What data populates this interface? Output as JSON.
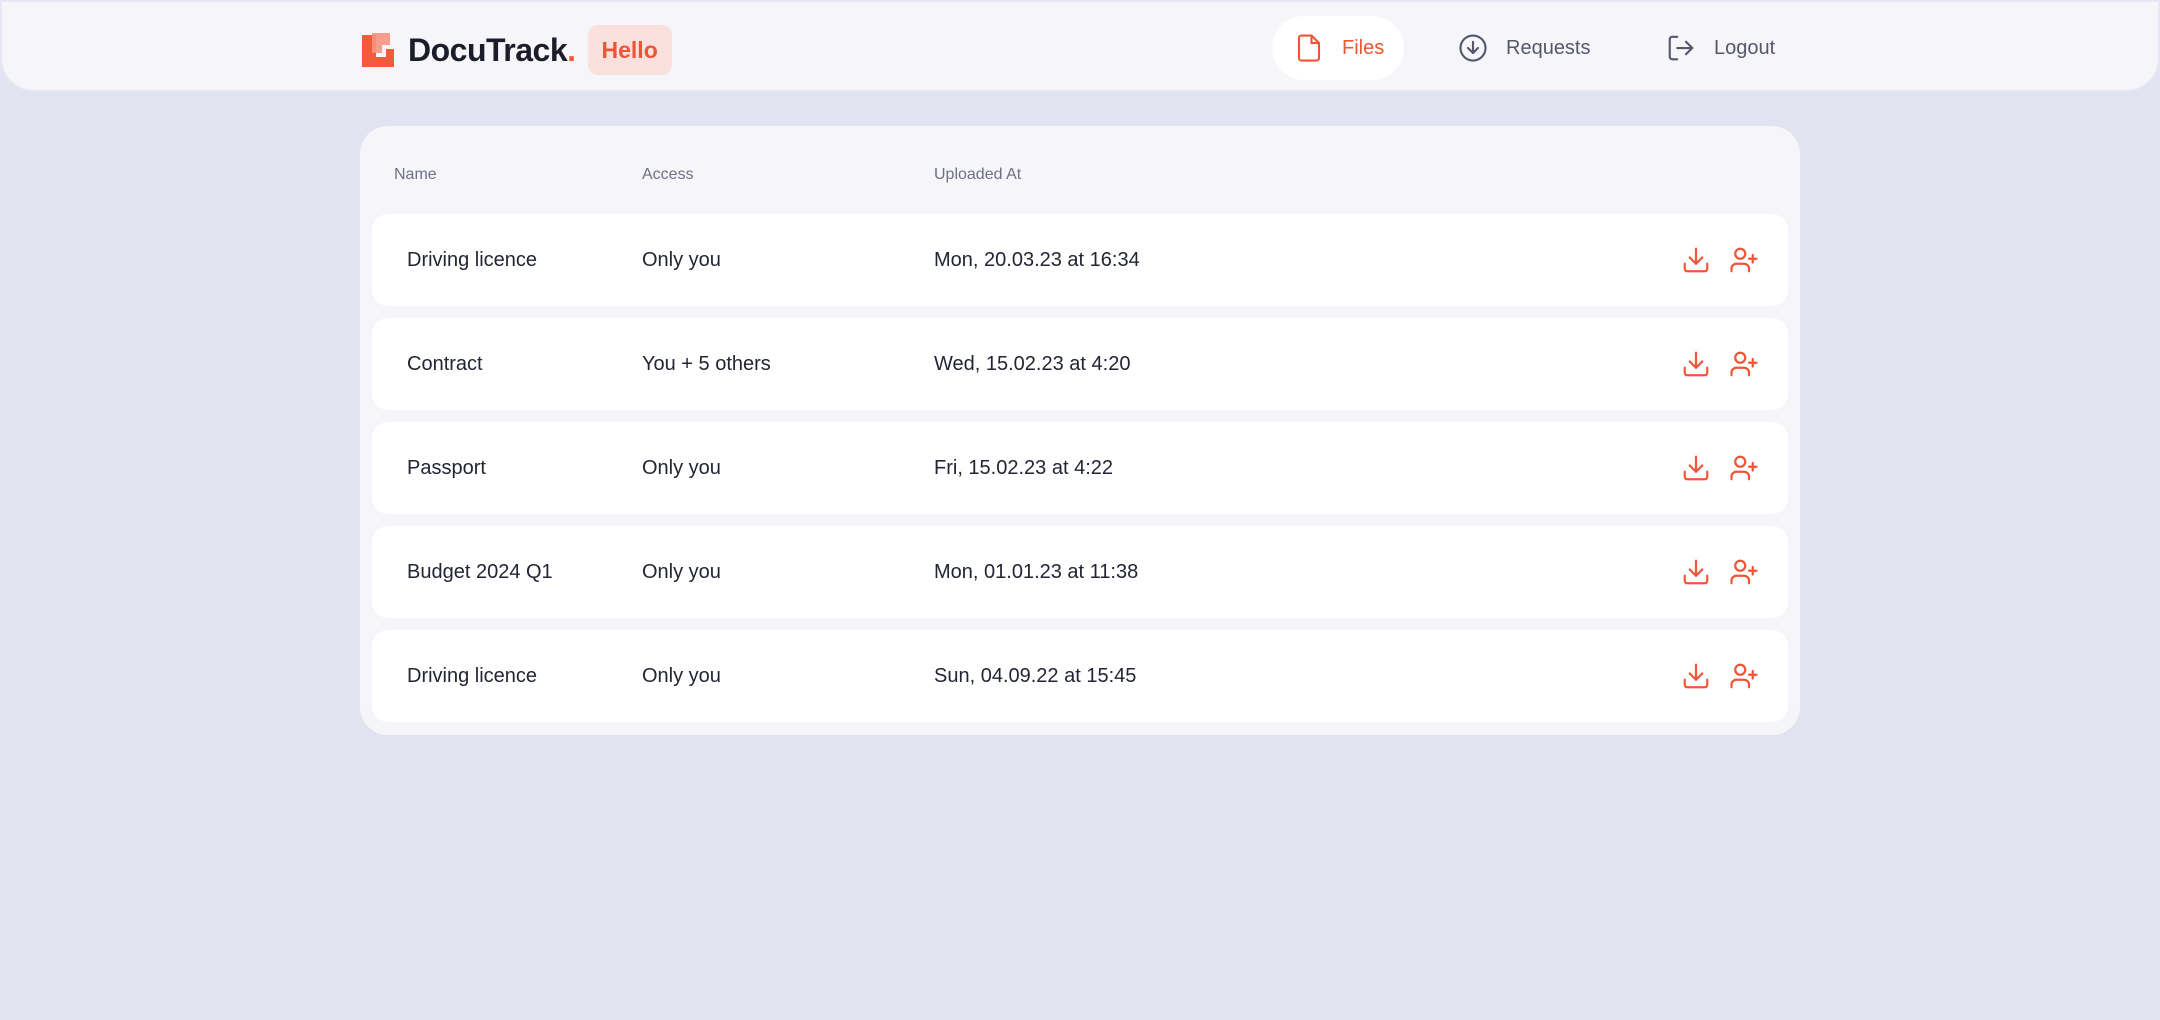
{
  "brand": {
    "name": "DocuTrack",
    "dot": ".",
    "badge": "Hello"
  },
  "nav": {
    "items": [
      {
        "label": "Files",
        "icon": "file-icon",
        "active": true
      },
      {
        "label": "Requests",
        "icon": "arrow-down-circle-icon",
        "active": false
      },
      {
        "label": "Logout",
        "icon": "logout-icon",
        "active": false
      }
    ]
  },
  "table": {
    "headers": {
      "name": "Name",
      "access": "Access",
      "uploaded": "Uploaded At"
    },
    "rows": [
      {
        "name": "Driving licence",
        "access": "Only you",
        "uploaded": "Mon, 20.03.23 at 16:34"
      },
      {
        "name": "Contract",
        "access": "You + 5 others",
        "uploaded": "Wed, 15.02.23 at 4:20"
      },
      {
        "name": "Passport",
        "access": "Only you",
        "uploaded": "Fri, 15.02.23 at 4:22"
      },
      {
        "name": "Budget 2024 Q1",
        "access": "Only you",
        "uploaded": "Mon, 01.01.23 at 11:38"
      },
      {
        "name": "Driving licence",
        "access": "Only you",
        "uploaded": "Sun, 04.09.22 at 15:45"
      }
    ],
    "row_actions": [
      "download-icon",
      "add-user-icon"
    ]
  },
  "colors": {
    "accent": "#EF5537",
    "background": "#E2E3F0",
    "panel": "#F6F5FA"
  }
}
